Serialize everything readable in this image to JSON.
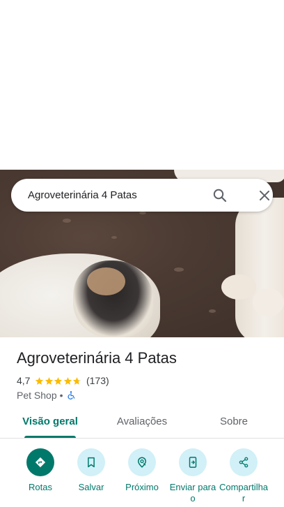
{
  "search": {
    "query": "Agroveterinária 4 Patas"
  },
  "place": {
    "name": "Agroveterinária 4 Patas",
    "rating": "4,7",
    "rating_value": 4.7,
    "reviews_count": "(173)",
    "category": "Pet Shop",
    "separator": "•"
  },
  "tabs": [
    {
      "label": "Visão geral",
      "active": true
    },
    {
      "label": "Avaliações",
      "active": false
    },
    {
      "label": "Sobre",
      "active": false
    }
  ],
  "actions": [
    {
      "label": "Rotas",
      "icon": "directions-icon"
    },
    {
      "label": "Salvar",
      "icon": "bookmark-icon"
    },
    {
      "label": "Próximo",
      "icon": "nearby-icon"
    },
    {
      "label": "Enviar para o",
      "icon": "send-to-phone-icon"
    },
    {
      "label": "Compartilhar",
      "icon": "share-icon"
    }
  ],
  "colors": {
    "accent": "#00796b",
    "action_bg": "#d1f0f7",
    "star": "#fbbc04"
  }
}
